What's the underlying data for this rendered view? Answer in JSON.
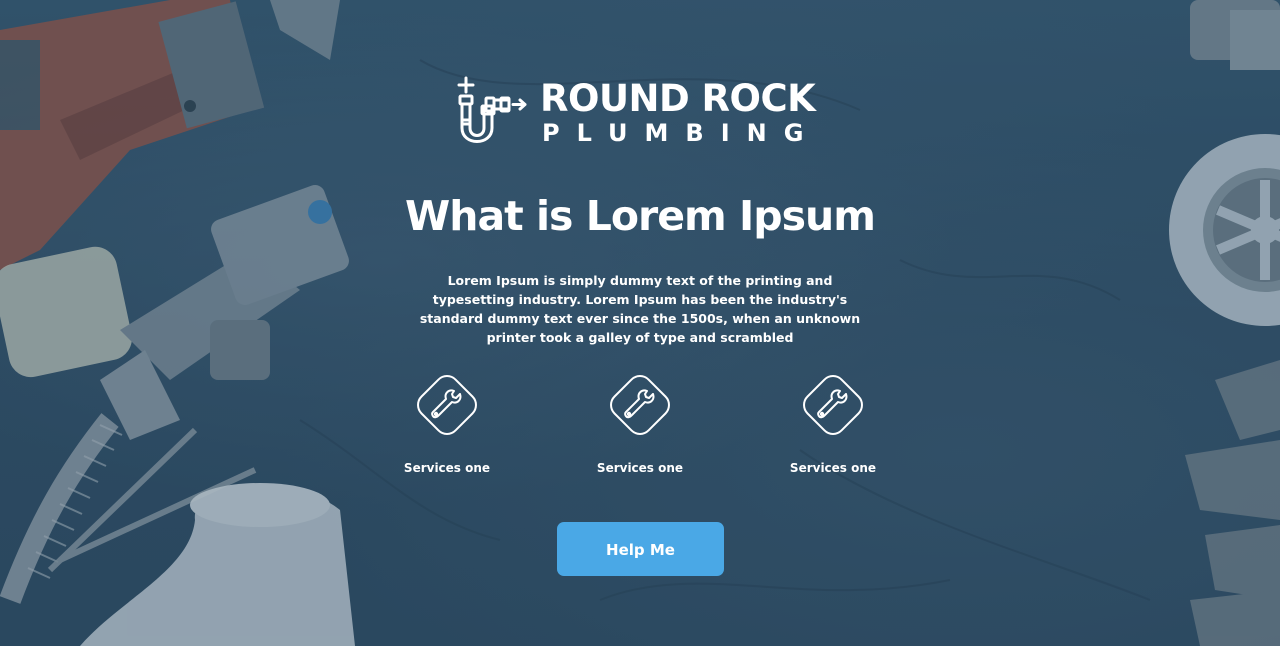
{
  "logo": {
    "line1": "ROUND ROCK",
    "line2": "PLUMBING",
    "icon": "plumbing-pipe-logo-icon"
  },
  "hero": {
    "title": "What is Lorem Ipsum",
    "description": "Lorem Ipsum is simply dummy text of the printing and typesetting industry. Lorem Ipsum has been the industry's standard dummy text ever since the 1500s, when an unknown printer took a galley of type and scrambled"
  },
  "services": [
    {
      "label": "Services one",
      "icon": "wrench-icon"
    },
    {
      "label": "Services one",
      "icon": "wrench-icon"
    },
    {
      "label": "Services one",
      "icon": "wrench-icon"
    }
  ],
  "cta": {
    "label": "Help Me"
  },
  "colors": {
    "overlay": "#2b4a62",
    "accent": "#4aa8e6",
    "text": "#ffffff"
  }
}
